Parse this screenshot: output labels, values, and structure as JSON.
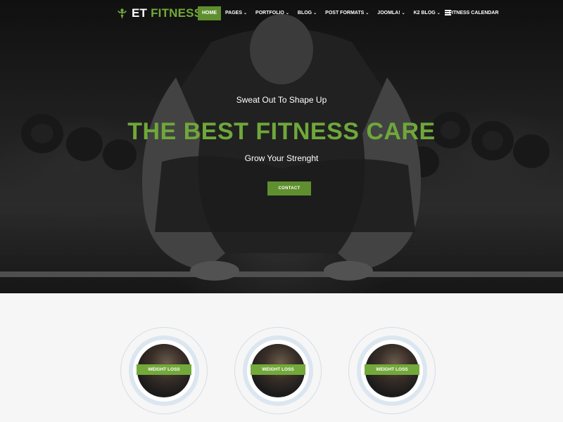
{
  "brand": {
    "name_prefix": "ET",
    "name_suffix": "FITNESS",
    "accent_color": "#72a93a",
    "logo_icon": "flexing-figure-icon"
  },
  "nav": {
    "items": [
      {
        "label": "HOME",
        "active": true,
        "has_dropdown": false
      },
      {
        "label": "PAGES",
        "active": false,
        "has_dropdown": true
      },
      {
        "label": "PORTFOLIO",
        "active": false,
        "has_dropdown": true
      },
      {
        "label": "BLOG",
        "active": false,
        "has_dropdown": true
      },
      {
        "label": "POST FORMATS",
        "active": false,
        "has_dropdown": true
      },
      {
        "label": "JOOMLA!",
        "active": false,
        "has_dropdown": true
      },
      {
        "label": "K2 BLOG",
        "active": false,
        "has_dropdown": true
      },
      {
        "label": "FITNESS CALENDAR",
        "active": false,
        "has_dropdown": false
      }
    ],
    "menu_icon": "hamburger-menu-icon"
  },
  "hero": {
    "tagline": "Sweat Out To Shape Up",
    "headline": "THE BEST FITNESS CARE",
    "subline": "Grow Your Strenght",
    "cta_label": "CONTACT"
  },
  "services": [
    {
      "label": "WEIGHT LOSS"
    },
    {
      "label": "WEIGHT LOSS"
    },
    {
      "label": "WEIGHT LOSS"
    }
  ]
}
